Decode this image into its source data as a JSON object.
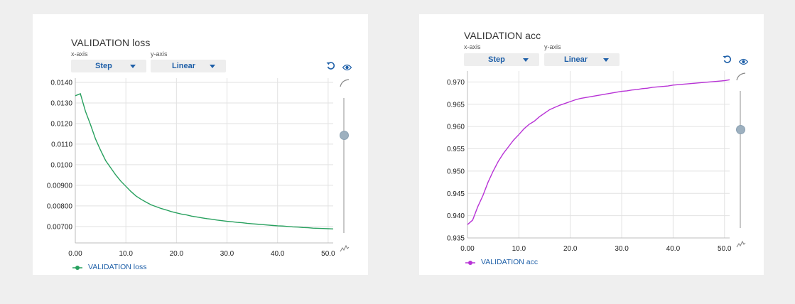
{
  "panels": [
    {
      "id": "loss",
      "title": "VALIDATION loss",
      "xaxis_label": "x-axis",
      "yaxis_label": "y-axis",
      "x_selector": "Step",
      "y_selector": "Linear",
      "legend": "VALIDATION loss",
      "color": "#27a05e"
    },
    {
      "id": "acc",
      "title": "VALIDATION acc",
      "xaxis_label": "x-axis",
      "yaxis_label": "y-axis",
      "x_selector": "Step",
      "y_selector": "Linear",
      "legend": "VALIDATION acc",
      "color": "#b833d6"
    }
  ],
  "icons": {
    "reset": "reset-icon",
    "visibility": "eye-icon",
    "smoothing_max": "curve-icon",
    "smoothing_min": "jagged-icon"
  },
  "chart_data": [
    {
      "type": "line",
      "title": "VALIDATION loss",
      "xlabel": "",
      "ylabel": "",
      "xlim": [
        0,
        51
      ],
      "ylim": [
        0.0062,
        0.014
      ],
      "xticks": [
        0,
        10,
        20,
        30,
        40,
        50
      ],
      "xtick_labels": [
        "0.00",
        "10.0",
        "20.0",
        "30.0",
        "40.0",
        "50.0"
      ],
      "yticks": [
        0.014,
        0.013,
        0.012,
        0.011,
        0.01,
        0.009,
        0.008,
        0.007
      ],
      "ytick_labels": [
        "0.0140",
        "0.0130",
        "0.0120",
        "0.0110",
        "0.0100",
        "0.00900",
        "0.00800",
        "0.00700"
      ],
      "grid": true,
      "legend_position": "bottom-left",
      "series": [
        {
          "name": "VALIDATION loss",
          "color": "#27a05e",
          "x": [
            0,
            1,
            2,
            3,
            4,
            5,
            6,
            7,
            8,
            9,
            10,
            11,
            12,
            13,
            14,
            15,
            16,
            17,
            18,
            19,
            20,
            21,
            22,
            23,
            24,
            25,
            26,
            27,
            28,
            29,
            30,
            31,
            32,
            33,
            34,
            35,
            36,
            37,
            38,
            39,
            40,
            41,
            42,
            43,
            44,
            45,
            46,
            47,
            48,
            49,
            50,
            51
          ],
          "y": [
            0.01335,
            0.01345,
            0.0126,
            0.01195,
            0.01125,
            0.0107,
            0.0102,
            0.00985,
            0.0095,
            0.0092,
            0.00895,
            0.0087,
            0.00848,
            0.00832,
            0.00818,
            0.00805,
            0.00796,
            0.00787,
            0.0078,
            0.00772,
            0.00766,
            0.0076,
            0.00756,
            0.0075,
            0.00746,
            0.00742,
            0.00738,
            0.00735,
            0.00731,
            0.00728,
            0.00725,
            0.00723,
            0.0072,
            0.00718,
            0.00715,
            0.00713,
            0.00711,
            0.00709,
            0.00707,
            0.00705,
            0.00703,
            0.00702,
            0.007,
            0.00698,
            0.00697,
            0.00695,
            0.00694,
            0.00692,
            0.00691,
            0.0069,
            0.00689,
            0.00688
          ]
        }
      ]
    },
    {
      "type": "line",
      "title": "VALIDATION acc",
      "xlabel": "",
      "ylabel": "",
      "xlim": [
        0,
        51
      ],
      "ylim": [
        0.935,
        0.9715
      ],
      "xticks": [
        0,
        10,
        20,
        30,
        40,
        50
      ],
      "xtick_labels": [
        "0.00",
        "10.0",
        "20.0",
        "30.0",
        "40.0",
        "50.0"
      ],
      "yticks": [
        0.97,
        0.965,
        0.96,
        0.955,
        0.95,
        0.945,
        0.94,
        0.935
      ],
      "ytick_labels": [
        "0.970",
        "0.965",
        "0.960",
        "0.955",
        "0.950",
        "0.945",
        "0.940",
        "0.935"
      ],
      "grid": true,
      "legend_position": "bottom-left",
      "series": [
        {
          "name": "VALIDATION acc",
          "color": "#b833d6",
          "x": [
            0,
            1,
            2,
            3,
            4,
            5,
            6,
            7,
            8,
            9,
            10,
            11,
            12,
            13,
            14,
            15,
            16,
            17,
            18,
            19,
            20,
            21,
            22,
            23,
            24,
            25,
            26,
            27,
            28,
            29,
            30,
            31,
            32,
            33,
            34,
            35,
            36,
            37,
            38,
            39,
            40,
            41,
            42,
            43,
            44,
            45,
            46,
            47,
            48,
            49,
            50,
            51
          ],
          "y": [
            0.938,
            0.939,
            0.942,
            0.9445,
            0.9475,
            0.95,
            0.9522,
            0.954,
            0.9555,
            0.957,
            0.9582,
            0.9595,
            0.9605,
            0.9612,
            0.9622,
            0.963,
            0.9638,
            0.9643,
            0.9648,
            0.9652,
            0.9656,
            0.966,
            0.9663,
            0.9665,
            0.9667,
            0.9669,
            0.9671,
            0.9673,
            0.9675,
            0.9677,
            0.9679,
            0.968,
            0.9682,
            0.9683,
            0.9685,
            0.9686,
            0.9688,
            0.9689,
            0.969,
            0.9691,
            0.9693,
            0.9694,
            0.9695,
            0.9696,
            0.9697,
            0.9698,
            0.9699,
            0.97,
            0.9701,
            0.9702,
            0.9703,
            0.9705
          ]
        }
      ]
    }
  ]
}
